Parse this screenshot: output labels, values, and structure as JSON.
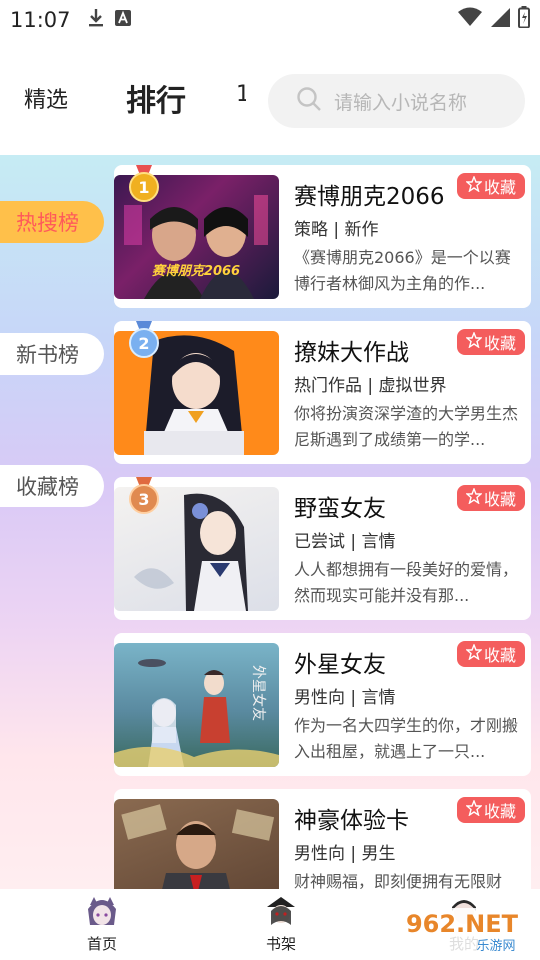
{
  "status_bar": {
    "time": "11:07",
    "icons": [
      "download-icon",
      "a-icon",
      "wifi-icon",
      "signal-icon",
      "battery-icon"
    ]
  },
  "header": {
    "tabs": [
      {
        "label": "精选",
        "active": false
      },
      {
        "label": "排行",
        "active": true
      },
      {
        "label": "1",
        "active": false
      }
    ],
    "search": {
      "placeholder": "请输入小说名称",
      "icon": "search-icon"
    }
  },
  "side_tabs": [
    {
      "label": "热搜榜",
      "active": true
    },
    {
      "label": "新书榜",
      "active": false
    },
    {
      "label": "收藏榜",
      "active": false
    }
  ],
  "books": [
    {
      "rank": "1",
      "title": "赛博朋克2066",
      "tags": "策略 | 新作",
      "desc": "《赛博朋克2066》是一个以赛博行者林御风为主角的作...",
      "fav_label": "收藏",
      "cover_text": "赛博朋克2066"
    },
    {
      "rank": "2",
      "title": "撩妹大作战",
      "tags": "热门作品 | 虚拟世界",
      "desc": "你将扮演资深学渣的大学男生杰尼斯遇到了成绩第一的学...",
      "fav_label": "收藏"
    },
    {
      "rank": "3",
      "title": "野蛮女友",
      "tags": "已尝试 | 言情",
      "desc": "人人都想拥有一段美好的爱情，然而现实可能并没有那...",
      "fav_label": "收藏"
    },
    {
      "title": "外星女友",
      "tags": "男性向 | 言情",
      "desc": "作为一名大四学生的你，才刚搬入出租屋，就遇上了一只...",
      "fav_label": "收藏",
      "cover_text": "外星女友"
    },
    {
      "title": "神豪体验卡",
      "tags": "男性向 | 男生",
      "desc": "财神赐福，即刻便拥有无限财富...",
      "fav_label": "收藏"
    }
  ],
  "bottom_nav": [
    {
      "label": "首页"
    },
    {
      "label": "书架"
    },
    {
      "label": "我的"
    }
  ],
  "watermark": {
    "text": "962.NET",
    "subtext": "乐游网"
  },
  "colors": {
    "accent_red": "#f45d5d",
    "active_tab_bg": "#ffc04a",
    "active_tab_text": "#ff5a5a"
  }
}
